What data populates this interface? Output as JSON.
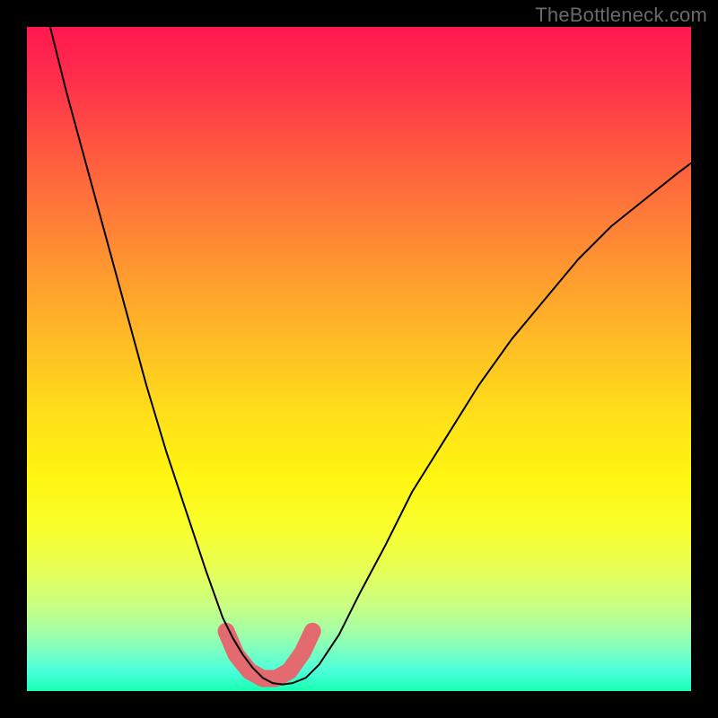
{
  "watermark": "TheBottleneck.com",
  "chart_data": {
    "type": "line",
    "title": "",
    "xlabel": "",
    "ylabel": "",
    "xlim": [
      0,
      1
    ],
    "ylim": [
      0,
      1
    ],
    "gradient_stops": [
      {
        "pos": 0.0,
        "color": "#ff1850"
      },
      {
        "pos": 0.08,
        "color": "#ff2f4b"
      },
      {
        "pos": 0.18,
        "color": "#ff5640"
      },
      {
        "pos": 0.28,
        "color": "#ff7a38"
      },
      {
        "pos": 0.38,
        "color": "#ff9d2e"
      },
      {
        "pos": 0.48,
        "color": "#ffbe24"
      },
      {
        "pos": 0.58,
        "color": "#ffde1a"
      },
      {
        "pos": 0.68,
        "color": "#fff611"
      },
      {
        "pos": 0.76,
        "color": "#f8ff30"
      },
      {
        "pos": 0.82,
        "color": "#e6ff58"
      },
      {
        "pos": 0.87,
        "color": "#caff82"
      },
      {
        "pos": 0.91,
        "color": "#a4ffa6"
      },
      {
        "pos": 0.94,
        "color": "#7affc2"
      },
      {
        "pos": 0.97,
        "color": "#4affdc"
      },
      {
        "pos": 1.0,
        "color": "#18ffb0"
      }
    ],
    "series": [
      {
        "name": "bottleneck-curve",
        "stroke": "#000000",
        "stroke_width": 2,
        "x": [
          0.035,
          0.06,
          0.09,
          0.12,
          0.15,
          0.18,
          0.21,
          0.24,
          0.27,
          0.295,
          0.31,
          0.325,
          0.34,
          0.355,
          0.37,
          0.385,
          0.4,
          0.42,
          0.44,
          0.47,
          0.5,
          0.54,
          0.58,
          0.63,
          0.68,
          0.73,
          0.78,
          0.83,
          0.88,
          0.93,
          0.98,
          1.0
        ],
        "y": [
          1.0,
          0.9,
          0.79,
          0.68,
          0.57,
          0.46,
          0.36,
          0.27,
          0.18,
          0.11,
          0.08,
          0.055,
          0.035,
          0.02,
          0.012,
          0.01,
          0.012,
          0.02,
          0.04,
          0.085,
          0.145,
          0.22,
          0.3,
          0.38,
          0.46,
          0.53,
          0.59,
          0.65,
          0.7,
          0.74,
          0.78,
          0.795
        ]
      },
      {
        "name": "marker-outline",
        "stroke": "#e36a6f",
        "stroke_width": 19,
        "linecap": "round",
        "x": [
          0.3,
          0.315,
          0.335,
          0.355,
          0.375,
          0.395,
          0.415,
          0.43
        ],
        "y": [
          0.09,
          0.055,
          0.03,
          0.019,
          0.019,
          0.03,
          0.058,
          0.09
        ]
      }
    ],
    "annotations": []
  }
}
